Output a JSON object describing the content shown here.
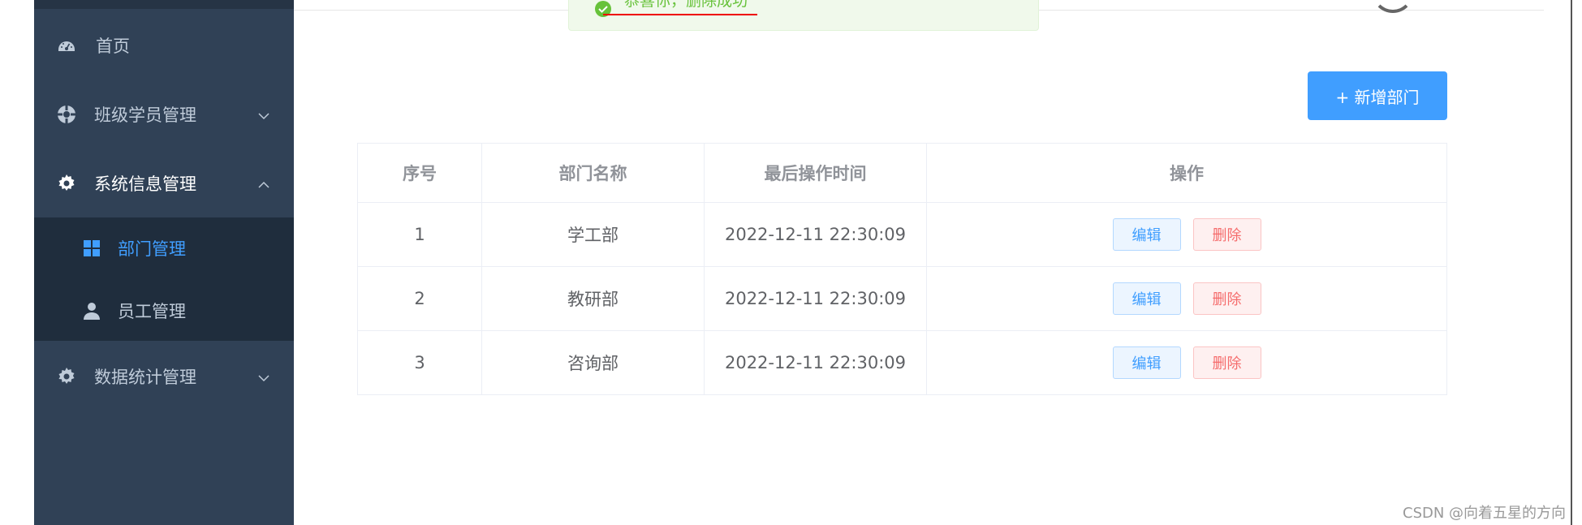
{
  "sidebar": {
    "items": [
      {
        "label": "首页",
        "icon": "dashboard-icon"
      },
      {
        "label": "班级学员管理",
        "icon": "compass-icon",
        "arrow": "chevron-down-icon"
      },
      {
        "label": "系统信息管理",
        "icon": "gear-icon",
        "arrow": "chevron-up-icon"
      },
      {
        "label": "数据统计管理",
        "icon": "gear-icon",
        "arrow": "chevron-down-icon"
      }
    ],
    "subitems": [
      {
        "label": "部门管理",
        "icon": "grid-icon",
        "active": true
      },
      {
        "label": "员工管理",
        "icon": "user-icon",
        "active": false
      }
    ]
  },
  "toast": {
    "message": "恭喜你，删除成功",
    "icon": "success-check-icon",
    "color": "#67c23a"
  },
  "toolbar": {
    "add_label": "+ 新增部门"
  },
  "table": {
    "headers": [
      "序号",
      "部门名称",
      "最后操作时间",
      "操作"
    ],
    "rows": [
      {
        "index": "1",
        "name": "学工部",
        "time": "2022-12-11 22:30:09"
      },
      {
        "index": "2",
        "name": "教研部",
        "time": "2022-12-11 22:30:09"
      },
      {
        "index": "3",
        "name": "咨询部",
        "time": "2022-12-11 22:30:09"
      }
    ],
    "edit_label": "编辑",
    "delete_label": "删除"
  },
  "watermark": "CSDN @向着五星的方向",
  "colors": {
    "sidebar_bg": "#304156",
    "submenu_bg": "#1f2d3d",
    "primary": "#409eff",
    "danger": "#f56c6c"
  }
}
